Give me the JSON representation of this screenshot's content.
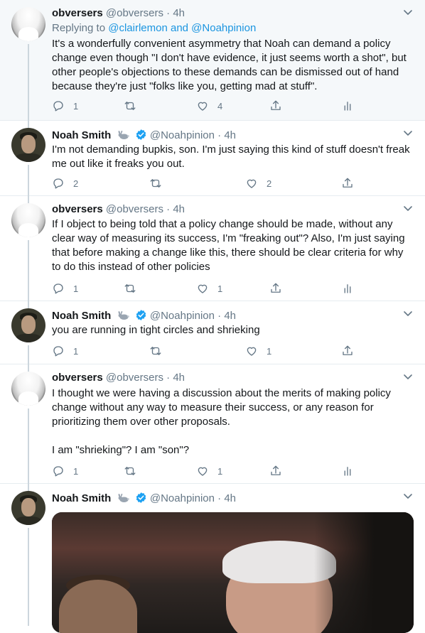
{
  "tweets": [
    {
      "name": "obversers",
      "handle": "@obversers",
      "time": "4h",
      "replying_prefix": "Replying to",
      "replying_to": "@clairlemon and @Noahpinion",
      "text": "It's a wonderfully convenient asymmetry that Noah can demand a policy\nchange even though \"I don't have evidence, it just seems worth a shot\", but\nother people's objections to these demands can be dismissed out of hand\nbecause they're just \"folks like you, getting mad at stuff\".",
      "replies": "1",
      "retweets": "",
      "likes": "4"
    },
    {
      "name": "Noah Smith",
      "handle": "@Noahpinion",
      "time": "4h",
      "text": "I'm not demanding bupkis, son. I'm just saying this kind of stuff doesn't freak\nme out like it freaks you out.",
      "replies": "2",
      "retweets": "",
      "likes": "2"
    },
    {
      "name": "obversers",
      "handle": "@obversers",
      "time": "4h",
      "text": "If I object to being told that a policy change should be made, without any\nclear way of measuring its success, I'm \"freaking out\"? Also, I'm just saying\nthat before making a change like this, there should be clear criteria for why\nto do this instead of other policies",
      "replies": "1",
      "retweets": "",
      "likes": "1"
    },
    {
      "name": "Noah Smith",
      "handle": "@Noahpinion",
      "time": "4h",
      "text": "you are running in tight circles and shrieking",
      "replies": "1",
      "retweets": "",
      "likes": "1"
    },
    {
      "name": "obversers",
      "handle": "@obversers",
      "time": "4h",
      "text": "I thought we were having a discussion about the merits of making policy\nchange without any way to measure their success, or any reason for\nprioritizing them over other proposals.\n\nI am \"shrieking\"? I am \"son\"?",
      "replies": "1",
      "retweets": "",
      "likes": "1"
    },
    {
      "name": "Noah Smith",
      "handle": "@Noahpinion",
      "time": "4h"
    }
  ],
  "colors": {
    "accent": "#1da1f2",
    "muted": "#657786",
    "link": "#1b95e0",
    "highlight_bg": "#f5f8fa"
  }
}
